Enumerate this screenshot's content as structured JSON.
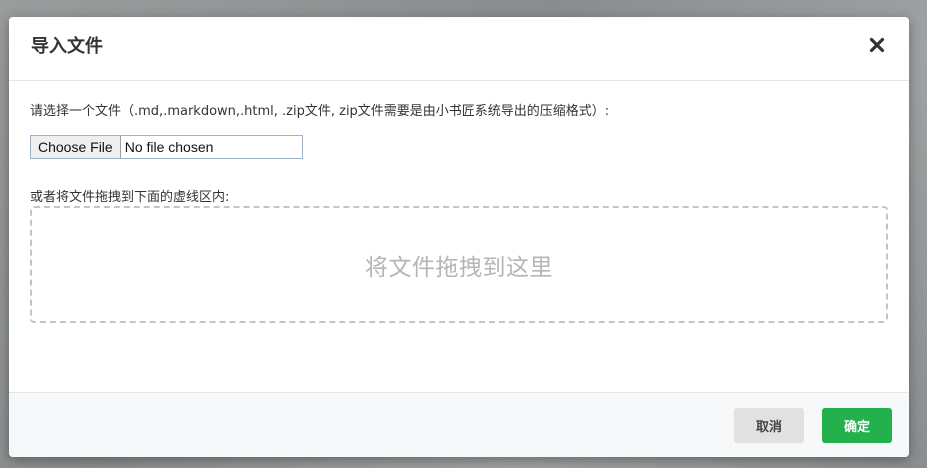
{
  "dialog": {
    "title": "导入文件",
    "close_icon": "close-icon"
  },
  "body": {
    "hint": "请选择一个文件（.md,.markdown,.html, .zip文件, zip文件需要是由小书匠系统导出的压缩格式）:",
    "file_input": {
      "button_label": "Choose File",
      "status": "No file chosen"
    },
    "drag_hint": "或者将文件拖拽到下面的虚线区内:",
    "drop_zone_text": "将文件拖拽到这里"
  },
  "footer": {
    "cancel_label": "取消",
    "ok_label": "确定"
  },
  "colors": {
    "ok_button": "#22b14c",
    "cancel_button": "#e1e1e1",
    "drop_border": "#c4c4c4"
  }
}
